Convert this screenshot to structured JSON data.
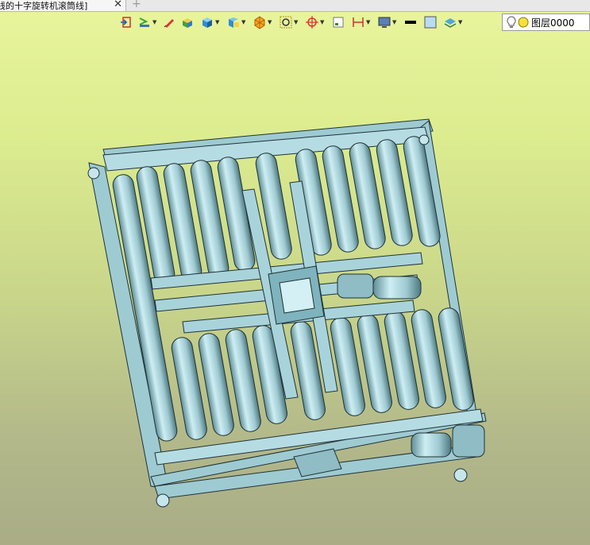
{
  "tab": {
    "title": "线的十字旋转机滚筒线]",
    "close": "✕",
    "add": "+"
  },
  "toolbar": {
    "items": [
      {
        "name": "exit-icon"
      },
      {
        "name": "line-style-icon"
      },
      {
        "name": "pen-icon"
      },
      {
        "name": "box-shaded-icon"
      },
      {
        "name": "cube-icon"
      },
      {
        "name": "view-orient-icon"
      },
      {
        "name": "render-mode-icon"
      },
      {
        "name": "zoom-icon"
      },
      {
        "name": "move-icon"
      },
      {
        "name": "fit-icon"
      },
      {
        "name": "dimension-icon"
      },
      {
        "name": "monitor-icon"
      },
      {
        "name": "color-black-icon"
      },
      {
        "name": "color-light-icon"
      },
      {
        "name": "layers-icon"
      }
    ]
  },
  "layer": {
    "name": "图层0000",
    "bulb": "lightbulb-icon",
    "dot": "sun-icon"
  },
  "colors": {
    "steel": "#a8d4dc",
    "steel_dark": "#5f8e97",
    "edge": "#1e3237",
    "bg_top": "#e9f59c",
    "bg_bottom": "#a9ac86"
  }
}
